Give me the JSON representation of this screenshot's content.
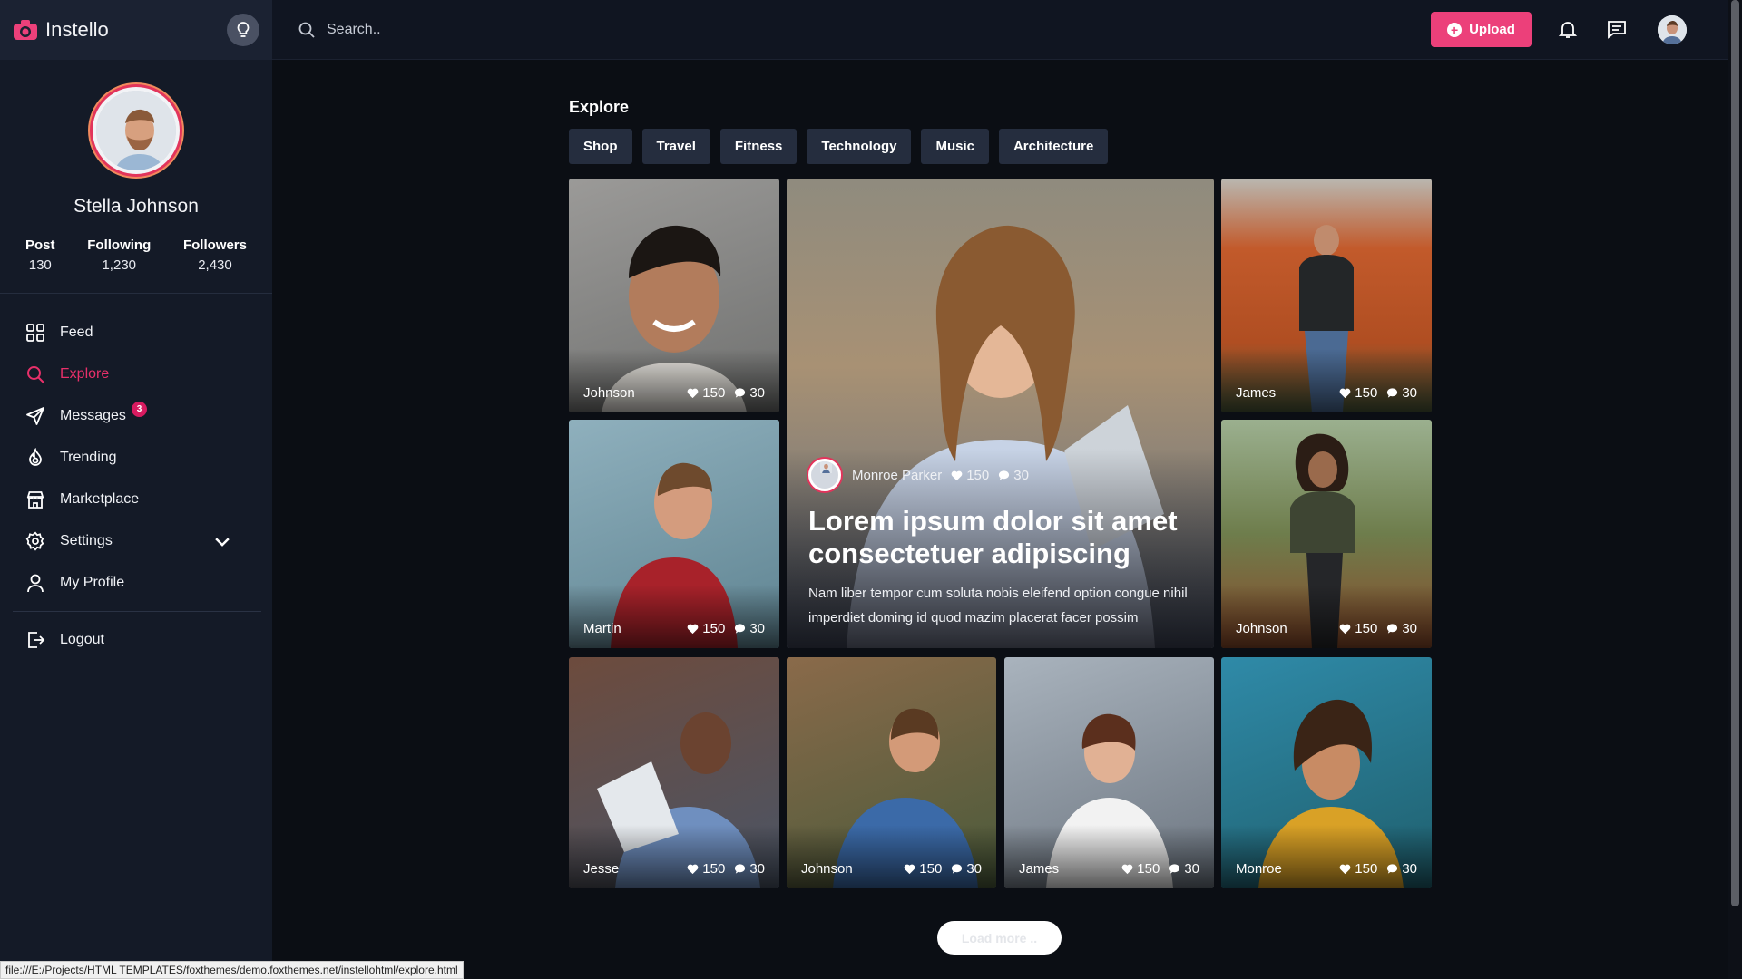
{
  "brand": {
    "name": "Instello"
  },
  "profile": {
    "name": "Stella Johnson",
    "stats": [
      {
        "label": "Post",
        "value": "130"
      },
      {
        "label": "Following",
        "value": "1,230"
      },
      {
        "label": "Followers",
        "value": "2,430"
      }
    ]
  },
  "nav": {
    "items": [
      {
        "label": "Feed",
        "icon": "grid-icon"
      },
      {
        "label": "Explore",
        "icon": "search-icon",
        "active": true
      },
      {
        "label": "Messages",
        "icon": "send-icon",
        "badge": "3"
      },
      {
        "label": "Trending",
        "icon": "fire-icon"
      },
      {
        "label": "Marketplace",
        "icon": "store-icon"
      },
      {
        "label": "Settings",
        "icon": "gear-icon"
      },
      {
        "label": "My Profile",
        "icon": "user-icon"
      }
    ],
    "logout": "Logout"
  },
  "topbar": {
    "search_placeholder": "Search..",
    "upload_label": "Upload"
  },
  "explore": {
    "title": "Explore",
    "categories": [
      "Shop",
      "Travel",
      "Fitness",
      "Technology",
      "Music",
      "Architecture"
    ],
    "cards": [
      {
        "name": "Johnson",
        "likes": "150",
        "comments": "30"
      },
      {
        "name": "James",
        "likes": "150",
        "comments": "30"
      },
      {
        "name": "Martin",
        "likes": "150",
        "comments": "30"
      },
      {
        "name": "Johnson",
        "likes": "150",
        "comments": "30"
      },
      {
        "name": "Jesse",
        "likes": "150",
        "comments": "30"
      },
      {
        "name": "Johnson",
        "likes": "150",
        "comments": "30"
      },
      {
        "name": "James",
        "likes": "150",
        "comments": "30"
      },
      {
        "name": "Monroe",
        "likes": "150",
        "comments": "30"
      }
    ],
    "feature": {
      "author": "Monroe Parker",
      "likes": "150",
      "comments": "30",
      "title": "Lorem ipsum dolor sit amet consectetuer adipiscing",
      "desc": "Nam liber tempor cum soluta nobis eleifend option congue nihil imperdiet doming id quod mazim placerat facer possim"
    },
    "load_more": "Load more .."
  },
  "statusbar": {
    "url": "file:///E:/Projects/HTML TEMPLATES/foxthemes/demo.foxthemes.net/instellohtml/explore.html"
  },
  "colors": {
    "accent": "#ec407a",
    "sidebar_bg": "#141a27",
    "page_bg": "#0b0e14"
  }
}
